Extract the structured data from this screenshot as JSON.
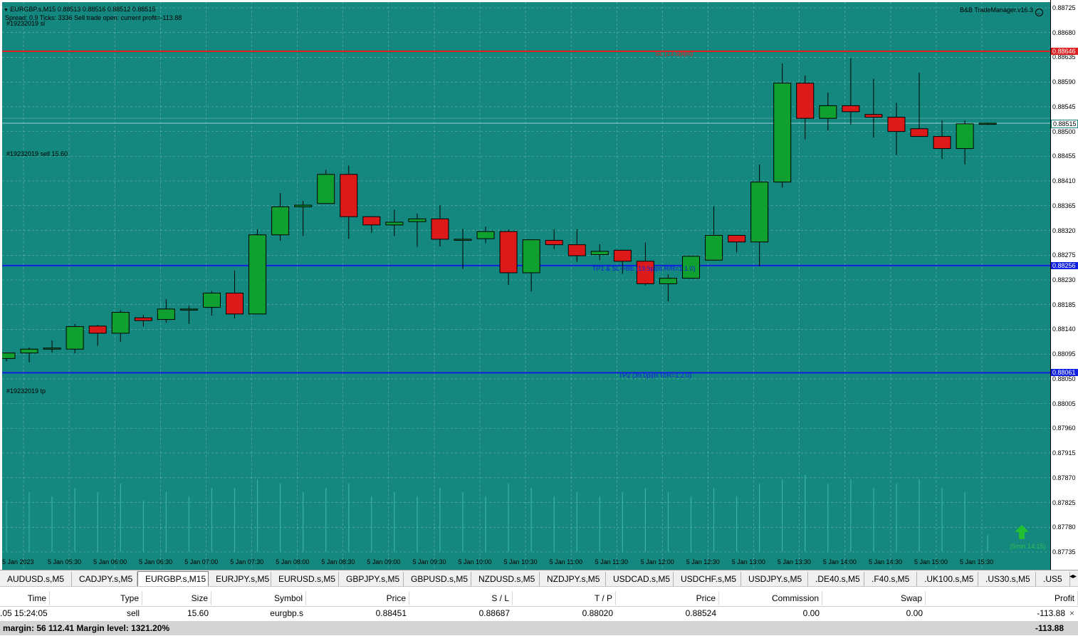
{
  "window": {
    "symbol_line": "EURGBP.s,M15  0.88513 0.88516 0.88512 0.88515",
    "spread_line": "Spread: 0.9  Ticks: 3336  Sell trade open: current profit=-113.88",
    "ticket_sl": "#19232019 sl",
    "ticket_sell": "#19232019 sell 15.60",
    "ticket_tp": "#19232019 tp",
    "ea_name": "B&B TradeManager.v16.3",
    "ea_icon": "smiley-icon",
    "signal_label": "(5min 14:15)",
    "signal_icon": "up-arrow-icon"
  },
  "colors": {
    "background": "#14877e",
    "bull": "#10a030",
    "bear": "#dd1a1a",
    "sl_line": "#e02020",
    "tp_line": "#1020e0",
    "grid": "#b5d8d3"
  },
  "levels": {
    "sl": {
      "price": 0.88646,
      "label": "SL (13.5pips)",
      "badge": "0.88646"
    },
    "tp1": {
      "price": 0.88256,
      "label": "TP1 & SL->BE (19.5pips R/R=1:1.0)",
      "badge": "0.88256"
    },
    "tp2": {
      "price": 0.88061,
      "label": "TP2 (39.0pips R/R=1:2.0)",
      "badge": "0.88061"
    },
    "entry": {
      "price": 0.88515,
      "badge": "0.88515"
    }
  },
  "price_axis": {
    "labels": [
      "0.88725",
      "0.88680",
      "0.88635",
      "0.88590",
      "0.88545",
      "0.88500",
      "0.88455",
      "0.88410",
      "0.88365",
      "0.88320",
      "0.88275",
      "0.88230",
      "0.88185",
      "0.88140",
      "0.88095",
      "0.88050",
      "0.88005",
      "0.87960",
      "0.87915",
      "0.87870",
      "0.87825",
      "0.87780",
      "0.87735"
    ]
  },
  "time_axis": {
    "labels": [
      "5 Jan 2023",
      "5 Jan 05:30",
      "5 Jan 06:00",
      "5 Jan 06:30",
      "5 Jan 07:00",
      "5 Jan 07:30",
      "5 Jan 08:00",
      "5 Jan 08:30",
      "5 Jan 09:00",
      "5 Jan 09:30",
      "5 Jan 10:00",
      "5 Jan 10:30",
      "5 Jan 11:00",
      "5 Jan 11:30",
      "5 Jan 12:00",
      "5 Jan 12:30",
      "5 Jan 13:00",
      "5 Jan 13:30",
      "5 Jan 14:00",
      "5 Jan 14:30",
      "5 Jan 15:00",
      "5 Jan 15:30"
    ]
  },
  "chart_data": {
    "type": "candlestick",
    "symbol": "EURGBP.s",
    "timeframe": "M15",
    "ylim": [
      0.87735,
      0.88725
    ],
    "candles": [
      {
        "o": 0.88087,
        "h": 0.88097,
        "l": 0.88082,
        "c": 0.88097
      },
      {
        "o": 0.88097,
        "h": 0.88107,
        "l": 0.8808,
        "c": 0.88104
      },
      {
        "o": 0.88104,
        "h": 0.8812,
        "l": 0.88098,
        "c": 0.88106
      },
      {
        "o": 0.88104,
        "h": 0.8815,
        "l": 0.88096,
        "c": 0.88145
      },
      {
        "o": 0.88146,
        "h": 0.88148,
        "l": 0.8811,
        "c": 0.88133
      },
      {
        "o": 0.88133,
        "h": 0.88175,
        "l": 0.88117,
        "c": 0.88171
      },
      {
        "o": 0.88161,
        "h": 0.88166,
        "l": 0.88145,
        "c": 0.88156
      },
      {
        "o": 0.88158,
        "h": 0.88195,
        "l": 0.88152,
        "c": 0.88177
      },
      {
        "o": 0.88177,
        "h": 0.88183,
        "l": 0.8815,
        "c": 0.88177
      },
      {
        "o": 0.8818,
        "h": 0.8821,
        "l": 0.88165,
        "c": 0.88206
      },
      {
        "o": 0.88206,
        "h": 0.88247,
        "l": 0.8816,
        "c": 0.88168
      },
      {
        "o": 0.88168,
        "h": 0.88322,
        "l": 0.88168,
        "c": 0.88312
      },
      {
        "o": 0.88312,
        "h": 0.88388,
        "l": 0.88301,
        "c": 0.88363
      },
      {
        "o": 0.88363,
        "h": 0.88374,
        "l": 0.8831,
        "c": 0.88366
      },
      {
        "o": 0.88369,
        "h": 0.8843,
        "l": 0.88369,
        "c": 0.88422
      },
      {
        "o": 0.88422,
        "h": 0.88438,
        "l": 0.88305,
        "c": 0.88345
      },
      {
        "o": 0.88345,
        "h": 0.88343,
        "l": 0.88316,
        "c": 0.8833
      },
      {
        "o": 0.8833,
        "h": 0.88358,
        "l": 0.8831,
        "c": 0.88335
      },
      {
        "o": 0.88336,
        "h": 0.88351,
        "l": 0.8829,
        "c": 0.88341
      },
      {
        "o": 0.88341,
        "h": 0.88366,
        "l": 0.88291,
        "c": 0.88304
      },
      {
        "o": 0.88304,
        "h": 0.88323,
        "l": 0.8825,
        "c": 0.88304
      },
      {
        "o": 0.88305,
        "h": 0.88327,
        "l": 0.88297,
        "c": 0.88318
      },
      {
        "o": 0.88318,
        "h": 0.88322,
        "l": 0.88221,
        "c": 0.88243
      },
      {
        "o": 0.88243,
        "h": 0.88303,
        "l": 0.88209,
        "c": 0.88303
      },
      {
        "o": 0.88302,
        "h": 0.88322,
        "l": 0.88286,
        "c": 0.88294
      },
      {
        "o": 0.88294,
        "h": 0.88322,
        "l": 0.88263,
        "c": 0.88274
      },
      {
        "o": 0.88276,
        "h": 0.88295,
        "l": 0.88266,
        "c": 0.88282
      },
      {
        "o": 0.88284,
        "h": 0.88284,
        "l": 0.88241,
        "c": 0.88264
      },
      {
        "o": 0.88264,
        "h": 0.88298,
        "l": 0.8822,
        "c": 0.88223
      },
      {
        "o": 0.88223,
        "h": 0.8824,
        "l": 0.88191,
        "c": 0.88233
      },
      {
        "o": 0.88233,
        "h": 0.88274,
        "l": 0.88232,
        "c": 0.88273
      },
      {
        "o": 0.88266,
        "h": 0.88364,
        "l": 0.88266,
        "c": 0.88311
      },
      {
        "o": 0.88311,
        "h": 0.88305,
        "l": 0.8828,
        "c": 0.88299
      },
      {
        "o": 0.88299,
        "h": 0.8844,
        "l": 0.88255,
        "c": 0.88408
      },
      {
        "o": 0.88408,
        "h": 0.88624,
        "l": 0.88398,
        "c": 0.88588
      },
      {
        "o": 0.88588,
        "h": 0.88602,
        "l": 0.88486,
        "c": 0.88524
      },
      {
        "o": 0.88524,
        "h": 0.88571,
        "l": 0.88502,
        "c": 0.88547
      },
      {
        "o": 0.88547,
        "h": 0.88633,
        "l": 0.88513,
        "c": 0.88536
      },
      {
        "o": 0.88531,
        "h": 0.88596,
        "l": 0.88489,
        "c": 0.88526
      },
      {
        "o": 0.88526,
        "h": 0.88552,
        "l": 0.88457,
        "c": 0.885
      },
      {
        "o": 0.88505,
        "h": 0.88607,
        "l": 0.88497,
        "c": 0.88491
      },
      {
        "o": 0.88491,
        "h": 0.8852,
        "l": 0.8845,
        "c": 0.88469
      },
      {
        "o": 0.88469,
        "h": 0.8852,
        "l": 0.8844,
        "c": 0.88514
      },
      {
        "o": 0.88514,
        "h": 0.88516,
        "l": 0.88512,
        "c": 0.88515
      }
    ],
    "volumes": [
      12,
      14,
      13,
      15,
      14,
      16,
      12,
      14,
      13,
      15,
      15,
      17,
      16,
      14,
      15,
      16,
      13,
      14,
      13,
      15,
      14,
      13,
      16,
      15,
      13,
      14,
      13,
      14,
      15,
      14,
      13,
      15,
      13,
      16,
      17,
      18,
      16,
      17,
      15,
      16,
      17,
      15,
      14,
      4
    ]
  },
  "symbol_tabs": {
    "items": [
      "AUDUSD.s,M5",
      "CADJPY.s,M5",
      "EURGBP.s,M15",
      "EURJPY.s,M5",
      "EURUSD.s,M5",
      "GBPJPY.s,M5",
      "GBPUSD.s,M5",
      "NZDUSD.s,M5",
      "NZDJPY.s,M5",
      "USDCAD.s,M5",
      "USDCHF.s,M5",
      "USDJPY.s,M5",
      ".DE40.s,M5",
      ".F40.s,M5",
      ".UK100.s,M5",
      ".US30.s,M5",
      ".US5"
    ],
    "active": "EURGBP.s,M15",
    "scroll_icon": "scroll-arrows-icon"
  },
  "trade_table": {
    "headers": [
      "Time",
      "Type",
      "Size",
      "Symbol",
      "Price",
      "S / L",
      "T / P",
      "Price",
      "Commission",
      "Swap",
      "Profit"
    ],
    "row": [
      ".05 15:24:05",
      "sell",
      "15.60",
      "eurgbp.s",
      "0.88451",
      "0.88687",
      "0.88020",
      "0.88524",
      "0.00",
      "0.00",
      "-113.88"
    ],
    "close_icon": "close-icon",
    "summary_text": "margin: 56 112.41  Margin level: 1321.20%",
    "summary_profit": "-113.88"
  }
}
